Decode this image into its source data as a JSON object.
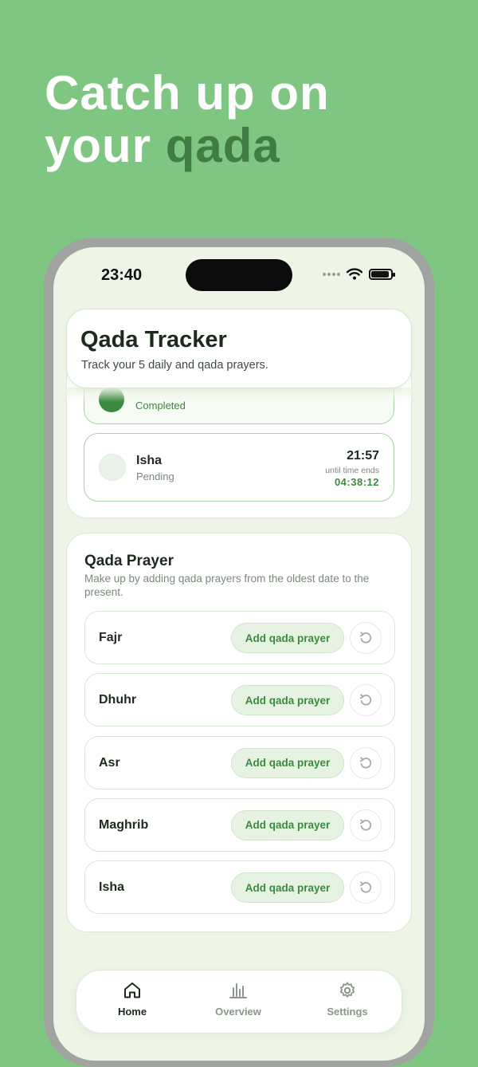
{
  "headline": {
    "line1": "Catch up on",
    "line2_start": "your ",
    "line2_accent": "qada"
  },
  "status_bar": {
    "time": "23:40"
  },
  "header": {
    "title": "Qada Tracker",
    "subtitle": "Track your 5 daily and qada prayers."
  },
  "daily_prayers": {
    "previous_status": "Completed",
    "current": {
      "name": "Isha",
      "status": "Pending",
      "time": "21:57",
      "until_label": "until time ends",
      "countdown": "04:38:12"
    }
  },
  "qada": {
    "title": "Qada Prayer",
    "description": "Make up by adding qada prayers from the oldest date to the present.",
    "add_label": "Add qada prayer",
    "prayers": [
      {
        "name": "Fajr"
      },
      {
        "name": "Dhuhr"
      },
      {
        "name": "Asr"
      },
      {
        "name": "Maghrib"
      },
      {
        "name": "Isha"
      }
    ]
  },
  "tabs": {
    "home": "Home",
    "overview": "Overview",
    "settings": "Settings"
  },
  "colors": {
    "background": "#80c683",
    "accent": "#3b8a3f",
    "headline_accent": "#3f7d42",
    "screen": "#eef5e7"
  }
}
